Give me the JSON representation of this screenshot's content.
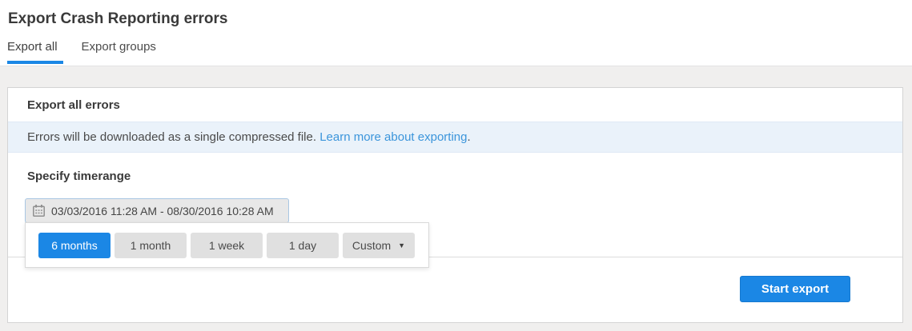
{
  "page": {
    "title": "Export Crash Reporting errors"
  },
  "tabs": [
    {
      "label": "Export all",
      "active": true
    },
    {
      "label": "Export groups",
      "active": false
    }
  ],
  "panel": {
    "header": "Export all errors",
    "banner": {
      "text": "Errors will be downloaded as a single compressed file. ",
      "link_text": "Learn more about exporting",
      "suffix": "."
    },
    "timerange": {
      "heading": "Specify timerange",
      "value": "03/03/2016 11:28 AM - 08/30/2016 10:28 AM",
      "quick_options": [
        "6 months",
        "1 month",
        "1 week",
        "1 day",
        "Custom"
      ],
      "selected_option": "6 months",
      "caret": "▼"
    },
    "footer": {
      "start_export": "Start export"
    }
  },
  "icons": {
    "calendar": "calendar-icon",
    "caret_down": "caret-down-icon"
  },
  "colors": {
    "accent_blue": "#1b87e5",
    "link_blue": "#3b95db",
    "banner_bg": "#eaf2fa"
  }
}
